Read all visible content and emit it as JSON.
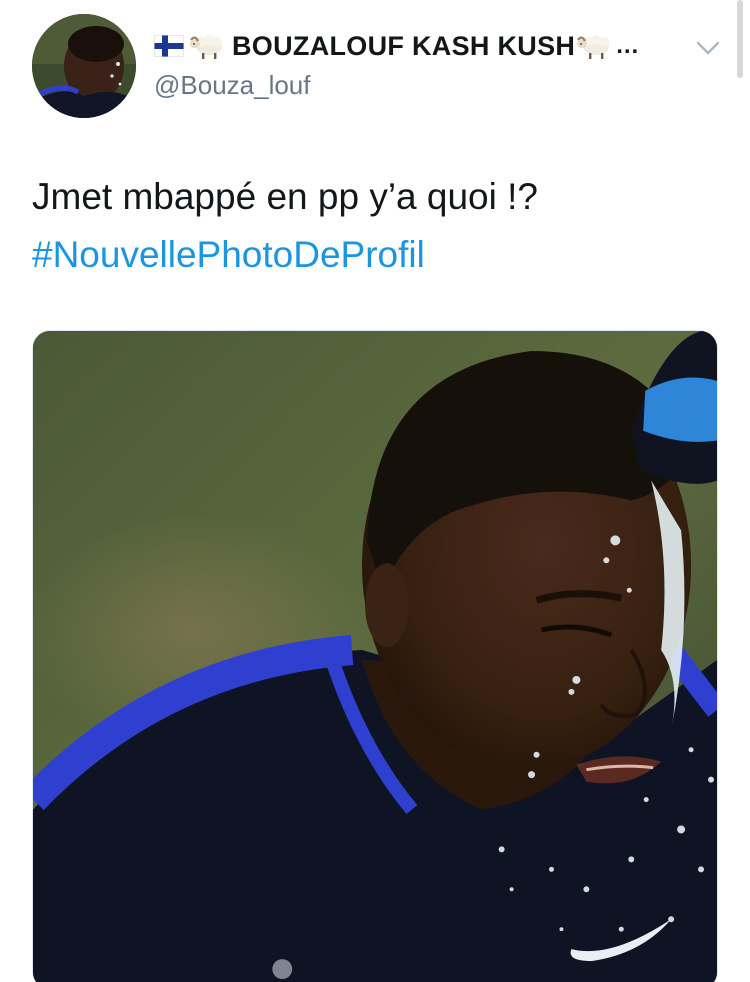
{
  "tweet": {
    "author": {
      "display_name": "BOUZALOUF KASH KUSH",
      "name_truncation": "…",
      "handle": "@Bouza_louf",
      "name_emojis": [
        "flag-finland-icon",
        "sheep-icon",
        "sheep-icon"
      ]
    },
    "text": "Jmet mbappé en pp y’a quoi !?",
    "hashtag": "#NouvellePhotoDeProfil",
    "menu_icon": "chevron-down-icon",
    "colors": {
      "link": "#1b95e0",
      "text": "#14171a",
      "secondary": "#657786",
      "jersey": "#0e1424",
      "jersey_trim": "#2f3fd0"
    },
    "media": {
      "alt_icon": "photo-icon"
    }
  }
}
